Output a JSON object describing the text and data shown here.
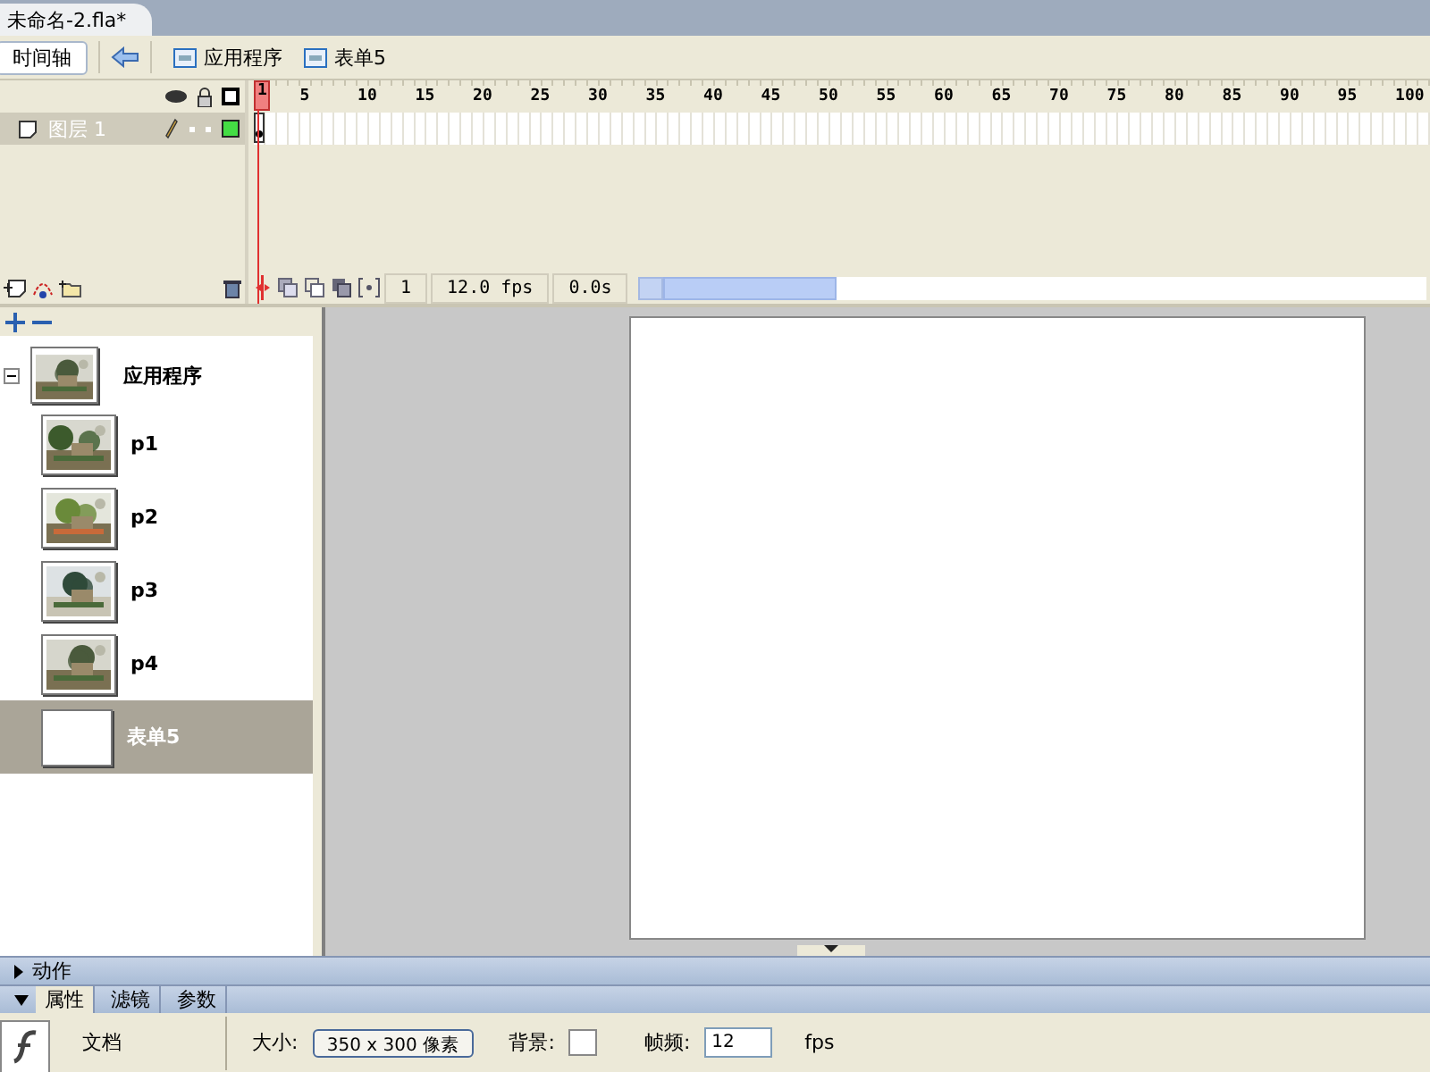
{
  "document_tab": {
    "title": "未命名-2.fla*",
    "selected": true
  },
  "toolbar": {
    "timeline_button": "时间轴",
    "breadcrumbs": [
      "应用程序",
      "表单5"
    ]
  },
  "timeline": {
    "ruler": [
      "1",
      "5",
      "10",
      "15",
      "20",
      "25",
      "30",
      "35",
      "40",
      "45",
      "50",
      "55",
      "60",
      "65",
      "70",
      "75",
      "80",
      "85",
      "90",
      "95",
      "100"
    ],
    "layers": [
      {
        "name": "图层 1",
        "selected": true
      }
    ],
    "status": {
      "frame": "1",
      "fps": "12.0 fps",
      "time": "0.0s"
    }
  },
  "screens": {
    "label": "应用程序",
    "expanded": true,
    "children": [
      {
        "label": "p1",
        "selected": false,
        "kind": "picture"
      },
      {
        "label": "p2",
        "selected": false,
        "kind": "picture"
      },
      {
        "label": "p3",
        "selected": false,
        "kind": "picture"
      },
      {
        "label": "p4",
        "selected": false,
        "kind": "picture"
      },
      {
        "label": "表单5",
        "selected": true,
        "kind": "blank"
      }
    ]
  },
  "actions_panel": {
    "title": "动作",
    "expanded": false
  },
  "properties": {
    "expanded": true,
    "tabs": [
      {
        "label": "属性",
        "selected": true
      },
      {
        "label": "滤镜",
        "selected": false
      },
      {
        "label": "参数",
        "selected": false
      }
    ],
    "type_label": "文档",
    "size_label": "大小:",
    "size_value": "350 x 300 像素",
    "background_label": "背景:",
    "framerate_label": "帧频:",
    "framerate_value": "12",
    "fps_unit": "fps"
  }
}
